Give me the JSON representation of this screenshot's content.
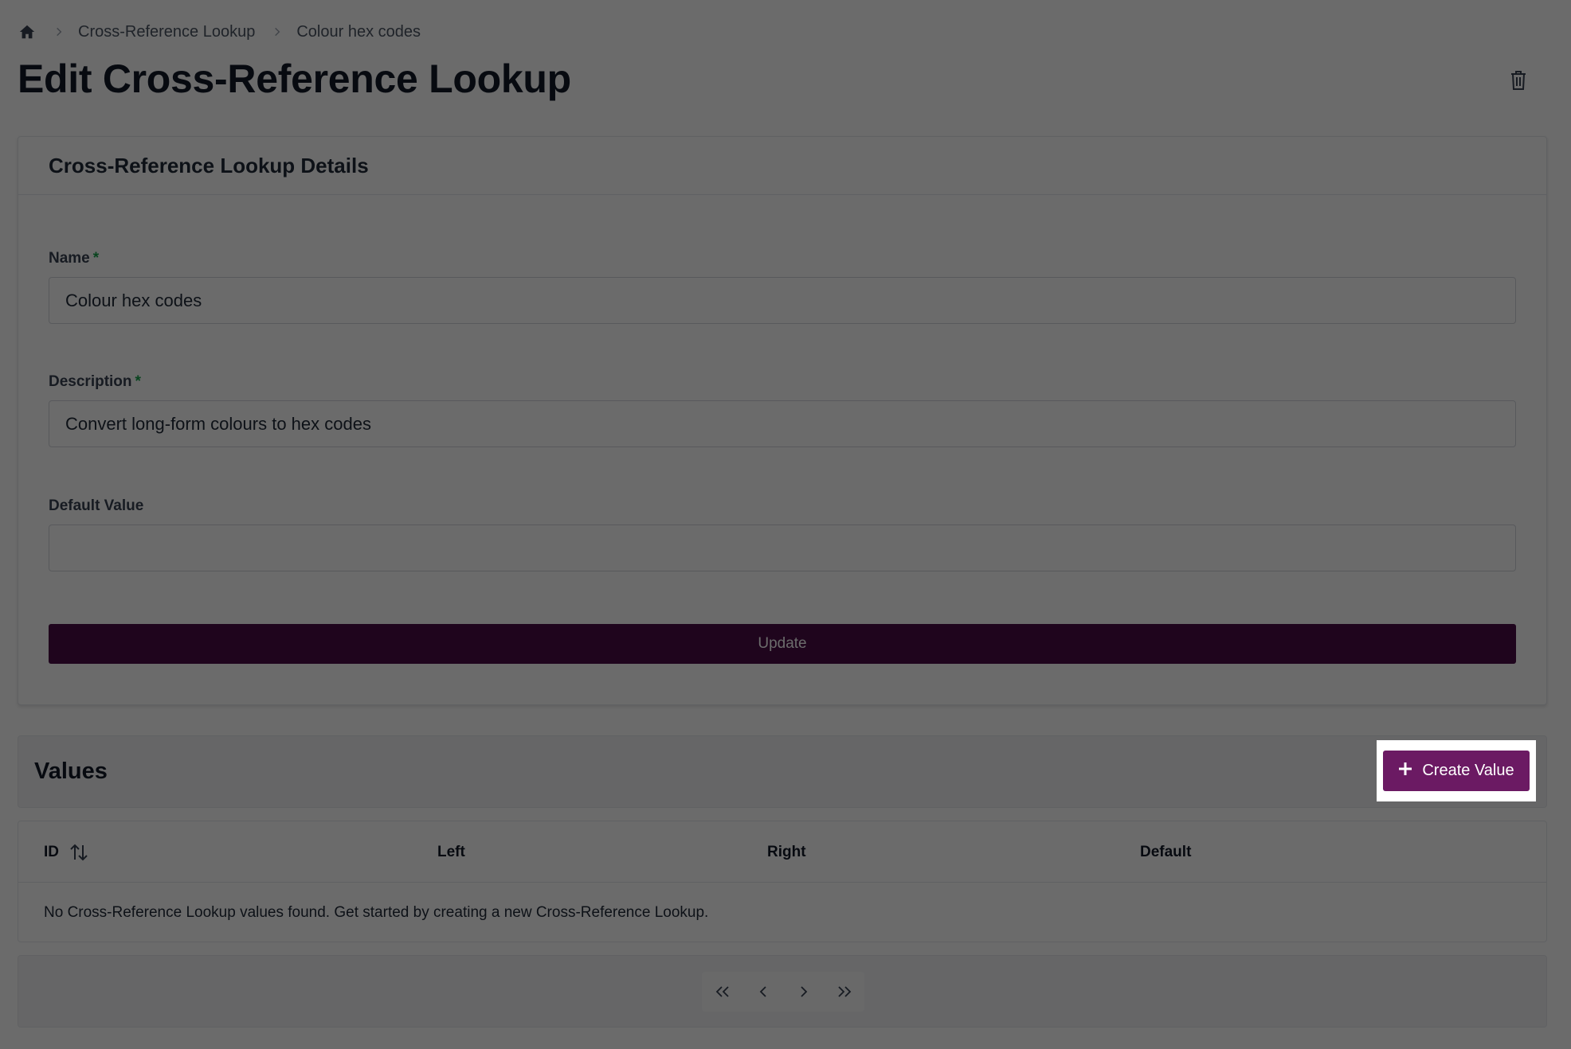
{
  "breadcrumb": {
    "home_icon": "home-icon",
    "items": [
      "Cross-Reference Lookup",
      "Colour hex codes"
    ]
  },
  "page": {
    "title": "Edit Cross-Reference Lookup",
    "delete_icon": "trash-icon"
  },
  "details": {
    "title": "Cross-Reference Lookup Details",
    "fields": {
      "name": {
        "label": "Name",
        "required_mark": "*",
        "value": "Colour hex codes"
      },
      "description": {
        "label": "Description",
        "required_mark": "*",
        "value": "Convert long-form colours to hex codes"
      },
      "default_value": {
        "label": "Default Value",
        "value": ""
      }
    },
    "update_label": "Update"
  },
  "values": {
    "title": "Values",
    "create_label": "Create Value",
    "create_icon": "plus-icon"
  },
  "table": {
    "columns": [
      "ID",
      "Left",
      "Right",
      "Default"
    ],
    "empty_message": "No Cross-Reference Lookup values found. Get started by creating a new Cross-Reference Lookup."
  },
  "pagination": {
    "icons": [
      "first-page-icon",
      "prev-page-icon",
      "next-page-icon",
      "last-page-icon"
    ]
  },
  "colors": {
    "brand": "#6b1a63",
    "required": "#16a34a"
  }
}
